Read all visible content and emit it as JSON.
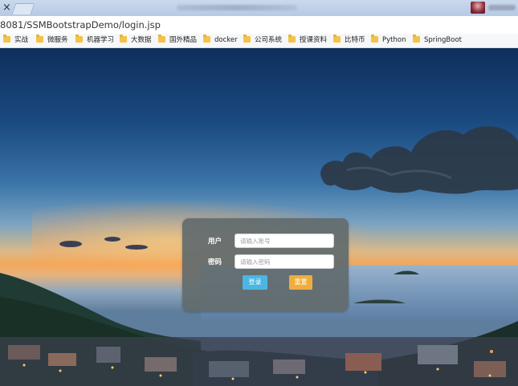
{
  "browser": {
    "url": "8081/SSMBootstrapDemo/login.jsp",
    "tab_close_glyph": "×"
  },
  "bookmarks": [
    {
      "label": "实战"
    },
    {
      "label": "微服务"
    },
    {
      "label": "机器学习"
    },
    {
      "label": "大数据"
    },
    {
      "label": "国外精品"
    },
    {
      "label": "docker"
    },
    {
      "label": "公司系统"
    },
    {
      "label": "授课资料"
    },
    {
      "label": "比特币"
    },
    {
      "label": "Python"
    },
    {
      "label": "SpringBoot"
    }
  ],
  "login": {
    "user_label": "用户",
    "user_value": "",
    "user_placeholder": "请输入账号",
    "password_label": "密码",
    "password_value": "",
    "password_placeholder": "请输入密码",
    "login_button": "登录",
    "reset_button": "重置"
  },
  "colors": {
    "panel_bg": "#626c6e",
    "login_button": "#4bb6e2",
    "reset_button": "#f0ad3e",
    "bookmark_folder": "#f2c24a"
  },
  "icons": {
    "bookmark": "folder-icon"
  }
}
